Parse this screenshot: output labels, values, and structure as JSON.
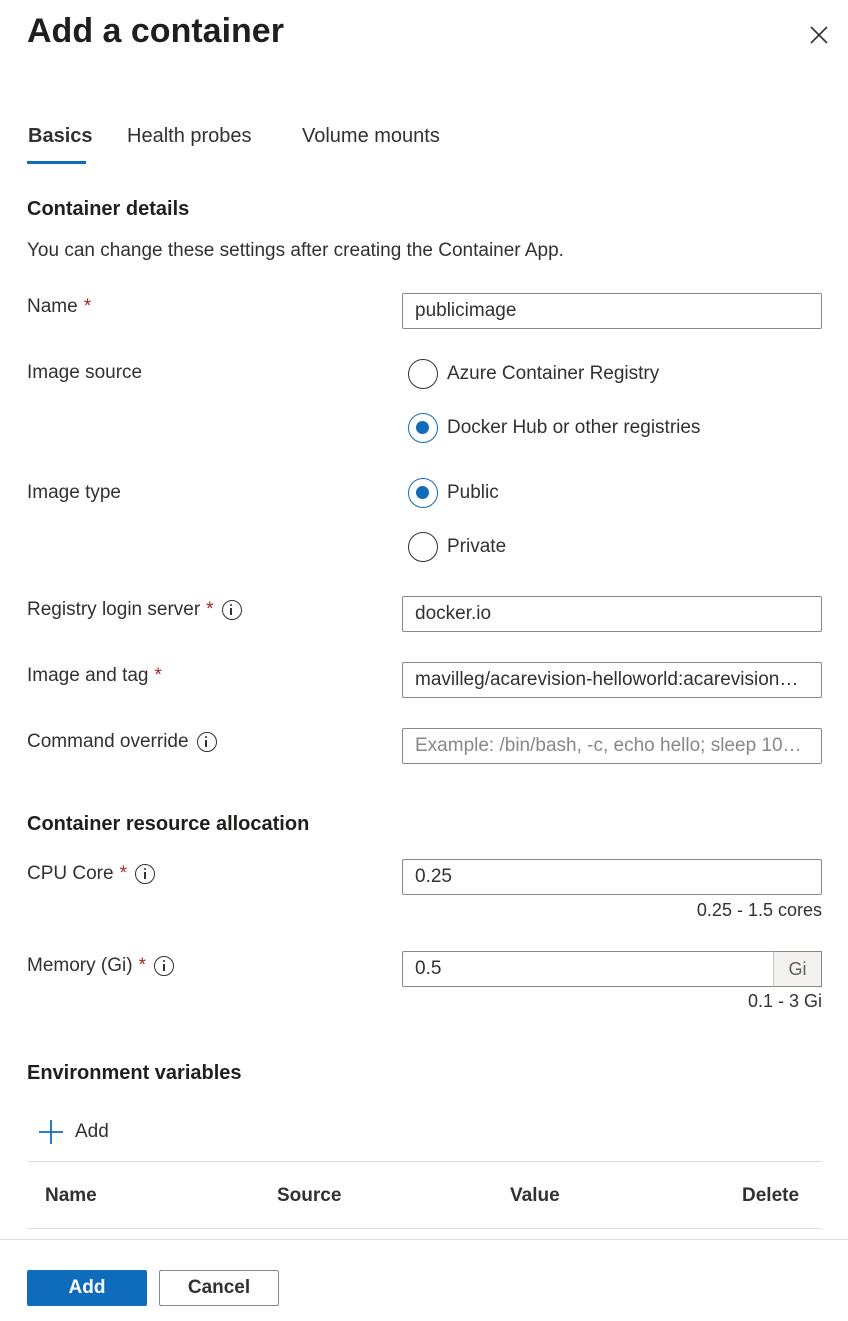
{
  "panel": {
    "title": "Add a container"
  },
  "tabs": [
    {
      "label": "Basics",
      "active": true
    },
    {
      "label": "Health probes",
      "active": false
    },
    {
      "label": "Volume mounts",
      "active": false
    }
  ],
  "container_details": {
    "heading": "Container details",
    "description": "You can change these settings after creating the Container App.",
    "name": {
      "label": "Name",
      "required_mark": "*",
      "value": "publicimage"
    },
    "image_source": {
      "label": "Image source",
      "options": [
        {
          "label": "Azure Container Registry",
          "checked": false
        },
        {
          "label": "Docker Hub or other registries",
          "checked": true
        }
      ]
    },
    "image_type": {
      "label": "Image type",
      "options": [
        {
          "label": "Public",
          "checked": true
        },
        {
          "label": "Private",
          "checked": false
        }
      ]
    },
    "registry_login_server": {
      "label": "Registry login server",
      "required_mark": "*",
      "info_icon": "info-icon",
      "value": "docker.io"
    },
    "image_and_tag": {
      "label": "Image and tag",
      "required_mark": "*",
      "value": "mavilleg/acarevision-helloworld:acarevision…"
    },
    "command_override": {
      "label": "Command override",
      "info_icon": "info-icon",
      "placeholder": "Example: /bin/bash, -c, echo hello; sleep 10…"
    }
  },
  "resource_allocation": {
    "heading": "Container resource allocation",
    "cpu": {
      "label": "CPU Core",
      "required_mark": "*",
      "info_icon": "info-icon",
      "value": "0.25",
      "hint": "0.25 - 1.5 cores"
    },
    "memory": {
      "label": "Memory (Gi)",
      "required_mark": "*",
      "info_icon": "info-icon",
      "value": "0.5",
      "suffix": "Gi",
      "hint": "0.1 - 3 Gi"
    }
  },
  "env_vars": {
    "heading": "Environment variables",
    "add_label": "Add",
    "columns": [
      "Name",
      "Source",
      "Value",
      "Delete"
    ]
  },
  "footer": {
    "add_label": "Add",
    "cancel_label": "Cancel"
  },
  "colors": {
    "accent": "#0f6cbd",
    "required": "#a4262c",
    "border": "#8a8886",
    "divider": "#e1dfdd"
  }
}
